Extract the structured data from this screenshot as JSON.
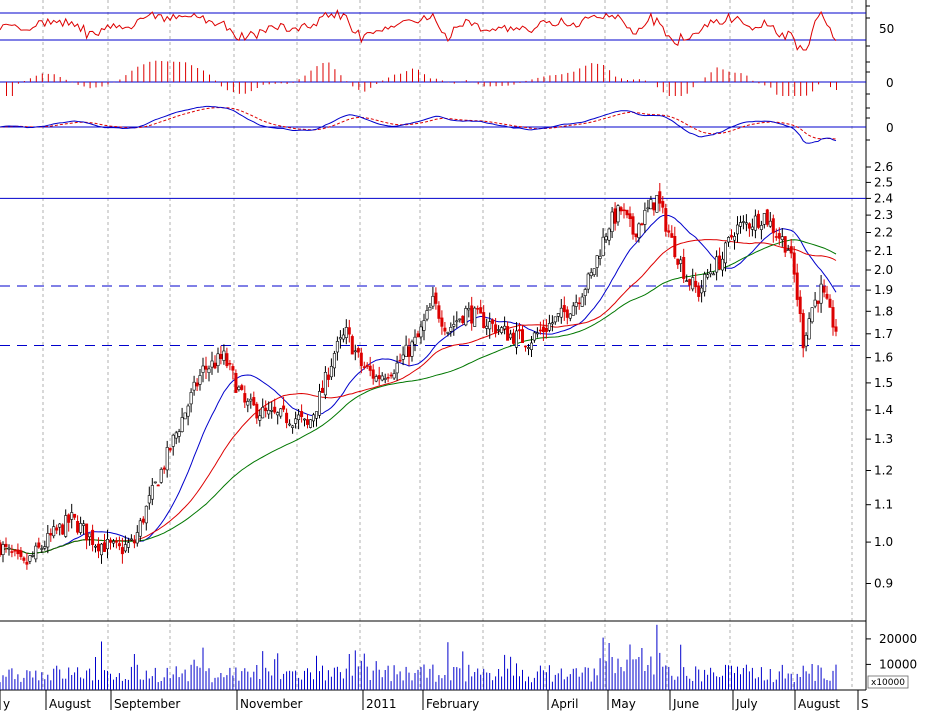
{
  "chart_data": {
    "type": "candlestick",
    "price_panel": {
      "y_ticks": [
        "0.9",
        "1.0",
        "1.1",
        "1.2",
        "1.3",
        "1.4",
        "1.5",
        "1.6",
        "1.7",
        "1.8",
        "1.9",
        "2.0",
        "2.1",
        "2.2",
        "2.3",
        "2.4",
        "2.5",
        "2.6"
      ],
      "y_tick_values": [
        0.9,
        1.0,
        1.1,
        1.2,
        1.3,
        1.4,
        1.5,
        1.6,
        1.7,
        1.8,
        1.9,
        2.0,
        2.1,
        2.2,
        2.3,
        2.4,
        2.5,
        2.6
      ],
      "ylim": [
        0.82,
        2.66
      ],
      "log_scale": true,
      "x_ticks": [
        "y",
        "August",
        "September",
        "November",
        "2011",
        "February",
        "April",
        "May",
        "June",
        "July",
        "August",
        "S"
      ],
      "horizontal_lines": [
        {
          "value": 2.4,
          "style": "solid",
          "color": "#0000cc"
        },
        {
          "value": 1.92,
          "style": "dashed",
          "color": "#0000cc"
        },
        {
          "value": 1.65,
          "style": "dashed",
          "color": "#0000cc"
        }
      ],
      "trend_knots": [
        [
          0,
          0.99
        ],
        [
          8,
          0.94
        ],
        [
          18,
          1.02
        ],
        [
          24,
          1.06
        ],
        [
          32,
          1.0
        ],
        [
          40,
          0.98
        ],
        [
          45,
          1.0
        ],
        [
          55,
          1.22
        ],
        [
          63,
          1.42
        ],
        [
          68,
          1.55
        ],
        [
          75,
          1.6
        ],
        [
          82,
          1.42
        ],
        [
          90,
          1.38
        ],
        [
          100,
          1.37
        ],
        [
          103,
          1.34
        ],
        [
          108,
          1.47
        ],
        [
          112,
          1.62
        ],
        [
          116,
          1.7
        ],
        [
          121,
          1.57
        ],
        [
          126,
          1.52
        ],
        [
          133,
          1.57
        ],
        [
          140,
          1.68
        ],
        [
          145,
          1.84
        ],
        [
          150,
          1.72
        ],
        [
          156,
          1.8
        ],
        [
          163,
          1.75
        ],
        [
          170,
          1.7
        ],
        [
          177,
          1.67
        ],
        [
          182,
          1.72
        ],
        [
          188,
          1.78
        ],
        [
          193,
          1.85
        ],
        [
          198,
          1.97
        ],
        [
          204,
          2.25
        ],
        [
          208,
          2.33
        ],
        [
          212,
          2.2
        ],
        [
          216,
          2.3
        ],
        [
          220,
          2.4
        ],
        [
          225,
          2.15
        ],
        [
          230,
          1.96
        ],
        [
          234,
          1.89
        ],
        [
          238,
          2.0
        ],
        [
          242,
          2.06
        ],
        [
          246,
          2.22
        ],
        [
          252,
          2.26
        ],
        [
          256,
          2.3
        ],
        [
          260,
          2.2
        ],
        [
          264,
          2.12
        ],
        [
          266,
          1.97
        ],
        [
          269,
          1.67
        ],
        [
          272,
          1.82
        ],
        [
          275,
          1.9
        ],
        [
          278,
          1.78
        ],
        [
          280,
          1.72
        ]
      ],
      "ma_fast_color": "#0000cc",
      "ma_mid_color": "#dd0000",
      "ma_slow_color": "#007700",
      "up_color": "#000000",
      "down_color": "#dd0000"
    },
    "indicator_top": {
      "y_tick": "50",
      "line_color": "#dd0000",
      "ref_color": "#0000cc"
    },
    "indicator_hist": {
      "y_tick": "0",
      "bar_color": "#dd0000"
    },
    "indicator_macd": {
      "y_tick": "0",
      "line_color": "#0000cc",
      "signal_color": "#dd0000"
    },
    "volume_panel": {
      "y_ticks": [
        "10000",
        "20000"
      ],
      "y_tick_values": [
        10000,
        20000
      ],
      "multiplier_label": "x10000",
      "bar_color": "#0000cc"
    },
    "colors": {
      "grid": "#b0b0b0",
      "frame": "#000000",
      "guide": "#0000cc"
    }
  }
}
